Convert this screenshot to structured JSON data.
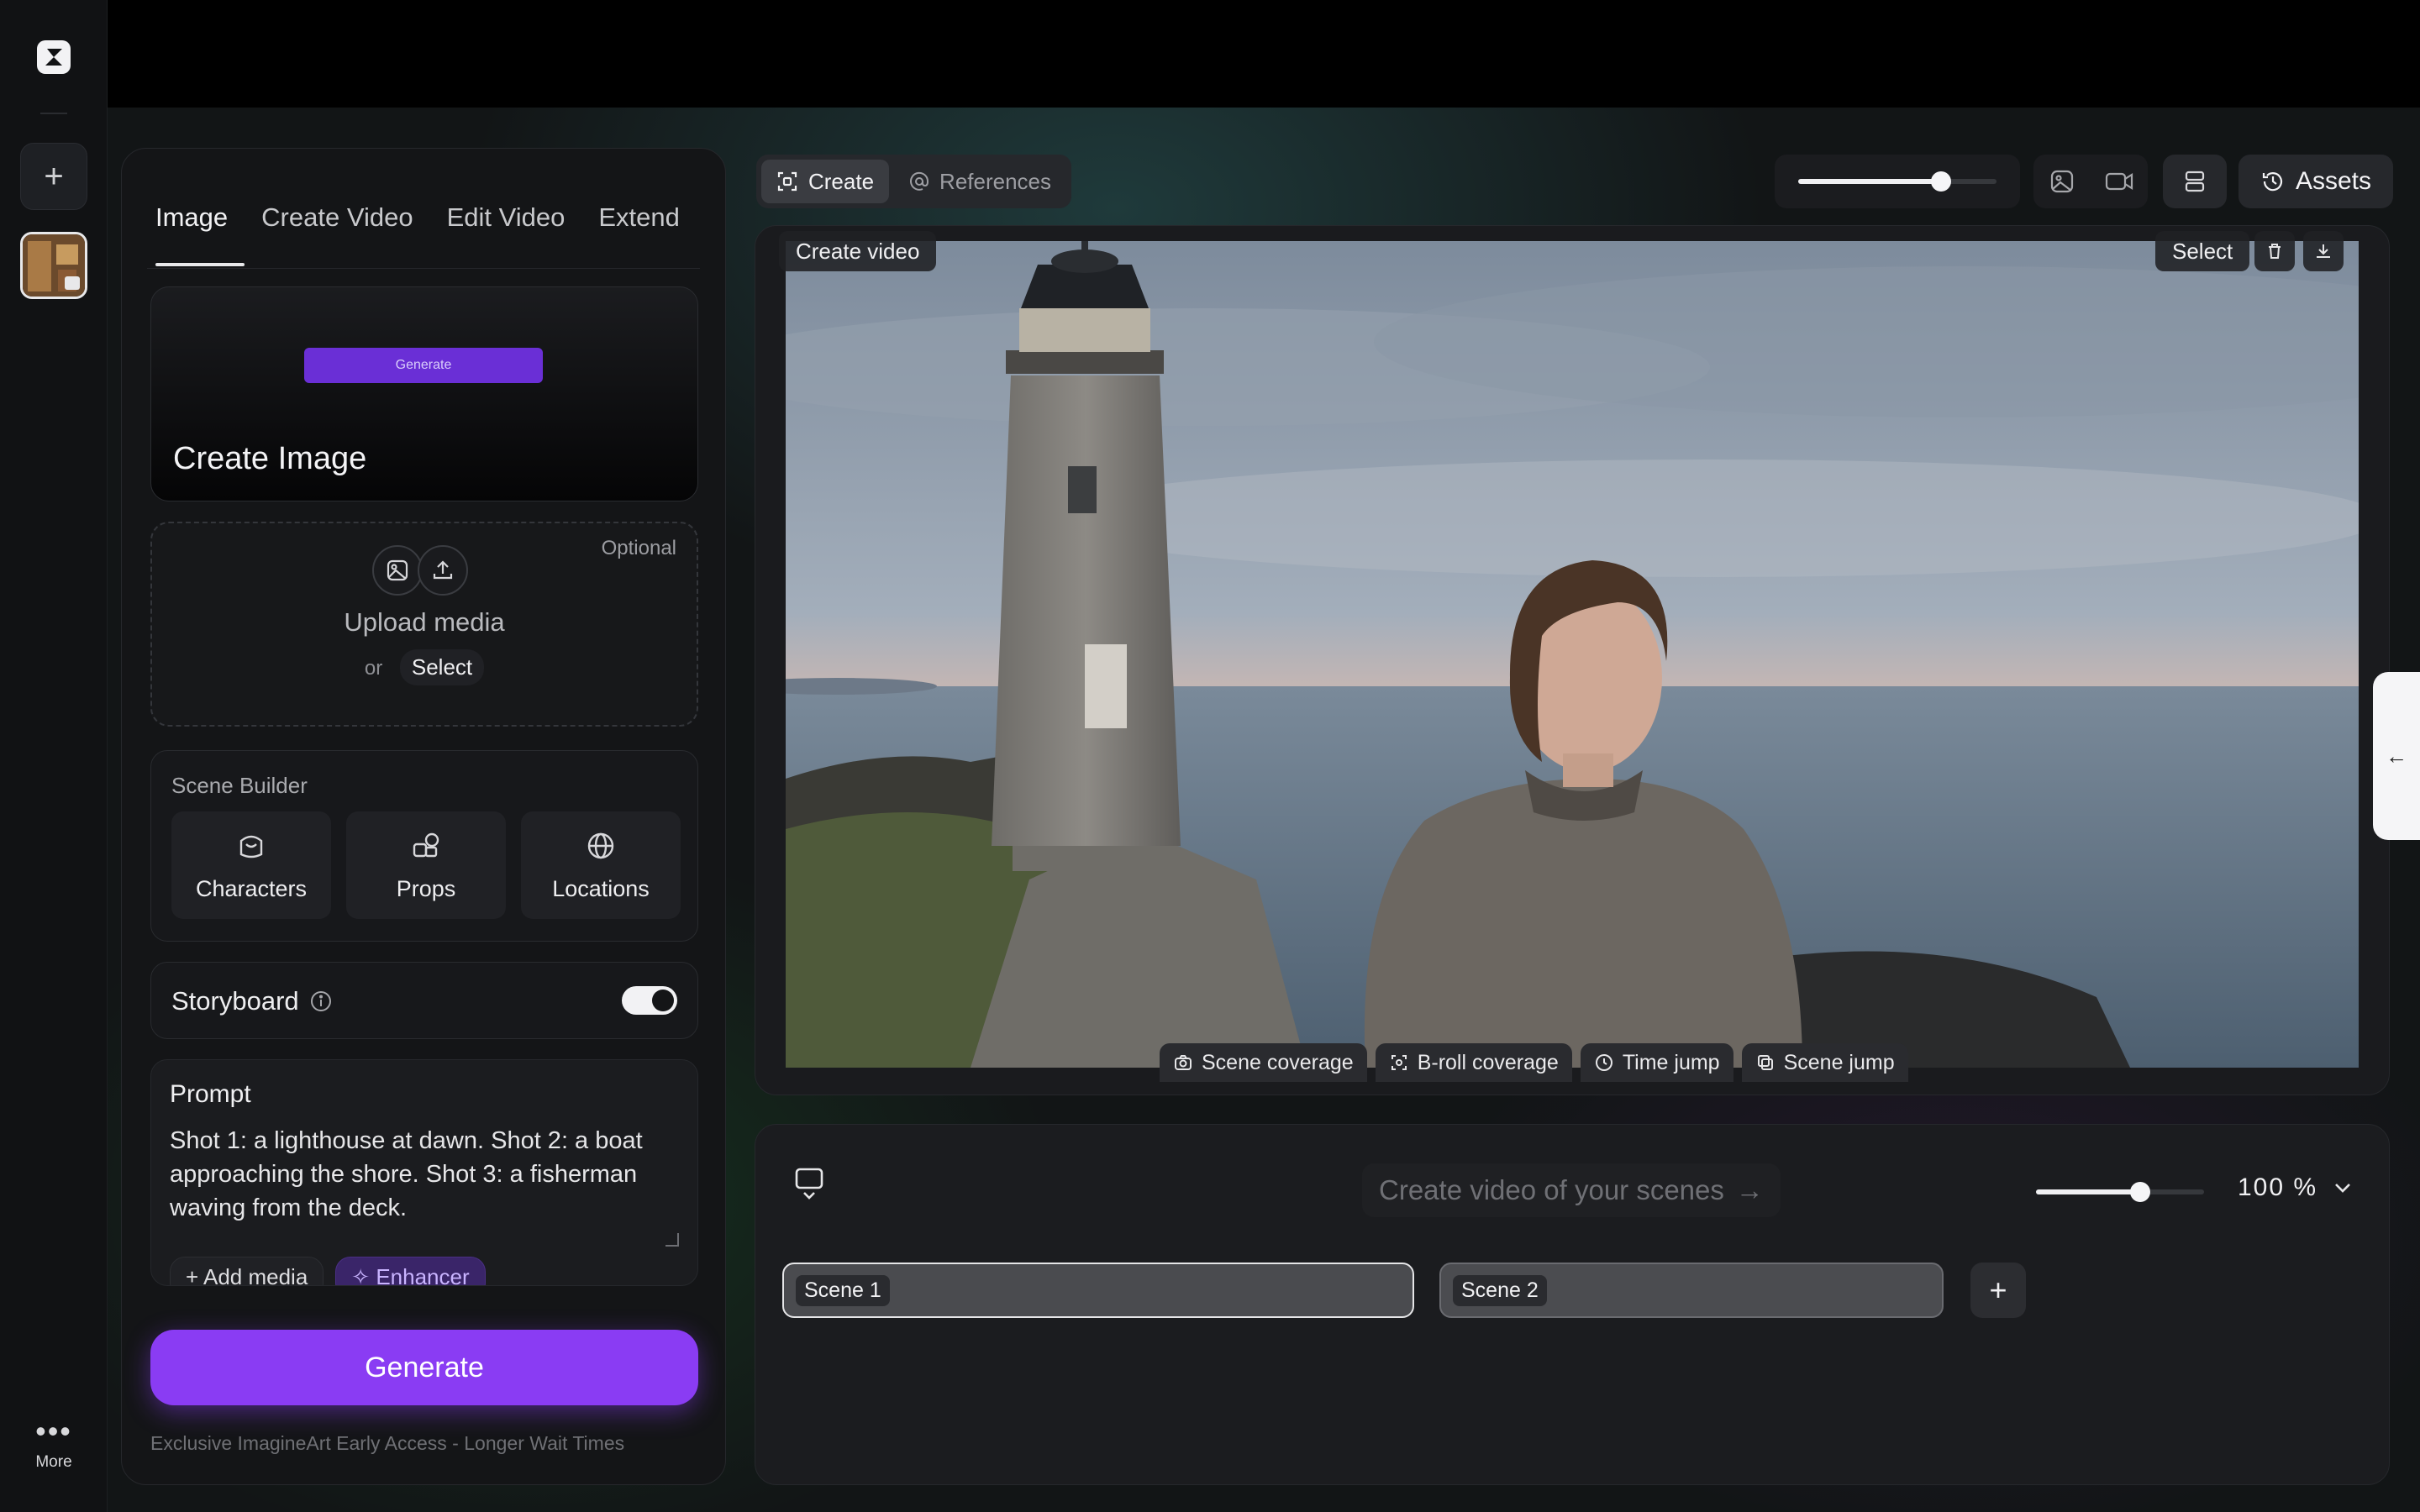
{
  "rail": {
    "more_label": "More"
  },
  "left_panel": {
    "tabs": [
      {
        "label": "Image",
        "active": true
      },
      {
        "label": "Create Video",
        "active": false
      },
      {
        "label": "Edit Video",
        "active": false
      },
      {
        "label": "Extend",
        "active": false
      }
    ],
    "create_card": {
      "mini_button": "Generate",
      "title": "Create Image"
    },
    "upload": {
      "optional": "Optional",
      "title": "Upload media",
      "or": "or",
      "select": "Select"
    },
    "scene_builder": {
      "title": "Scene Builder",
      "items": [
        {
          "label": "Characters",
          "icon": "characters-icon"
        },
        {
          "label": "Props",
          "icon": "props-icon"
        },
        {
          "label": "Locations",
          "icon": "globe-icon"
        }
      ]
    },
    "storyboard": {
      "label": "Storyboard",
      "enabled": true
    },
    "prompt": {
      "title": "Prompt",
      "text": "Shot 1: a lighthouse at dawn. Shot 2: a boat approaching the shore. Shot 3: a fisherman waving from the deck.",
      "add_media": "Add media",
      "enhancer": "Enhancer"
    },
    "generate": "Generate",
    "notice": "Exclusive ImagineArt Early Access - Longer Wait Times"
  },
  "toolbar": {
    "modes": [
      {
        "label": "Create",
        "active": true
      },
      {
        "label": "References",
        "active": false
      }
    ],
    "size_slider": 0.72,
    "assets": "Assets"
  },
  "preview": {
    "chip": "Create video",
    "select": "Select",
    "shot_types": [
      "Scene coverage",
      "B-roll coverage",
      "Time jump",
      "Scene jump"
    ]
  },
  "timeline": {
    "cta": "Create video of your scenes",
    "zoom_slider": 0.62,
    "zoom": "100 %",
    "scenes": [
      {
        "label": "Scene 1",
        "active": true
      },
      {
        "label": "Scene 2",
        "active": false
      }
    ]
  },
  "colors": {
    "accent": "#8a3cf3",
    "enhancer": "#3a2569"
  }
}
